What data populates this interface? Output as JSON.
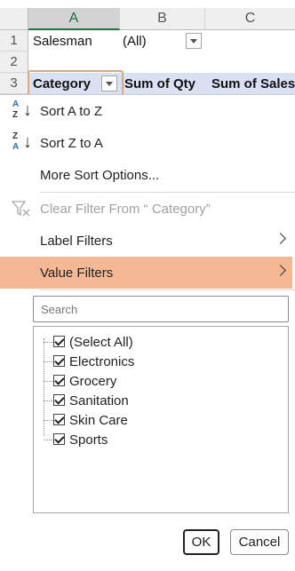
{
  "sheet": {
    "columns": [
      "A",
      "B",
      "C"
    ],
    "rows": [
      "1",
      "2",
      "3"
    ],
    "filter_label": "Salesman",
    "filter_value": "(All)",
    "header_row": [
      "Category",
      "Sum of Qty",
      "Sum of Sales"
    ]
  },
  "menu": {
    "sort_az": "Sort A to Z",
    "sort_za": "Sort Z to A",
    "more_sort": "More Sort Options...",
    "clear_filter": "Clear Filter From “ Category”",
    "label_filters": "Label Filters",
    "value_filters": "Value Filters",
    "search_placeholder": "Search",
    "items": [
      "(Select All)",
      "Electronics",
      "Grocery",
      "Sanitation",
      "Skin Care",
      "Sports"
    ],
    "ok": "OK",
    "cancel": "Cancel"
  },
  "colors": {
    "highlight": "#f4b895",
    "header_band": "#d9e1f2",
    "selected_column": "#217346",
    "dropdown_outline": "#e0a877"
  }
}
